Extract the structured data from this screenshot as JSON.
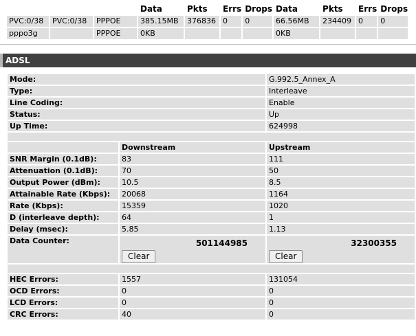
{
  "interfaces": {
    "headers": [
      "",
      "",
      "",
      "Data",
      "Pkts",
      "Errs",
      "Drops",
      "Data",
      "Pkts",
      "Errs",
      "Drops"
    ],
    "rows": [
      [
        "PVC:0/38",
        "PVC:0/38",
        "PPPOE",
        "385.15MB",
        "376836",
        "0",
        "0",
        "66.56MB",
        "234409",
        "0",
        "0"
      ],
      [
        "pppo3g",
        "",
        "PPPOE",
        "0KB",
        "",
        "",
        "",
        "0KB",
        "",
        "",
        ""
      ]
    ]
  },
  "adsl": {
    "title": "ADSL",
    "status": [
      {
        "label": "Mode:",
        "value": "G.992.5_Annex_A"
      },
      {
        "label": "Type:",
        "value": "Interleave"
      },
      {
        "label": "Line Coding:",
        "value": "Enable"
      },
      {
        "label": "Status:",
        "value": "Up"
      },
      {
        "label": "Up Time:",
        "value": "624998"
      }
    ],
    "columns": {
      "downstream": "Downstream",
      "upstream": "Upstream"
    },
    "line_stats": [
      {
        "label": "SNR Margin (0.1dB):",
        "down": "83",
        "up": "111"
      },
      {
        "label": "Attenuation (0.1dB):",
        "down": "70",
        "up": "50"
      },
      {
        "label": "Output Power (dBm):",
        "down": "10.5",
        "up": "8.5"
      },
      {
        "label": "Attainable Rate (Kbps):",
        "down": "20068",
        "up": "1164"
      },
      {
        "label": "Rate (Kbps):",
        "down": "15359",
        "up": "1020"
      },
      {
        "label": "D (interleave depth):",
        "down": "64",
        "up": "1"
      },
      {
        "label": "Delay (msec):",
        "down": "5.85",
        "up": "1.13"
      }
    ],
    "data_counter": {
      "label": "Data Counter:",
      "down": "501144985",
      "up": "32300355",
      "clear_label": "Clear"
    },
    "errors": [
      {
        "label": "HEC Errors:",
        "down": "1557",
        "up": "131054"
      },
      {
        "label": "OCD Errors:",
        "down": "0",
        "up": "0"
      },
      {
        "label": "LCD Errors:",
        "down": "0",
        "up": "0"
      },
      {
        "label": "CRC Errors:",
        "down": "40",
        "up": "0"
      }
    ]
  }
}
